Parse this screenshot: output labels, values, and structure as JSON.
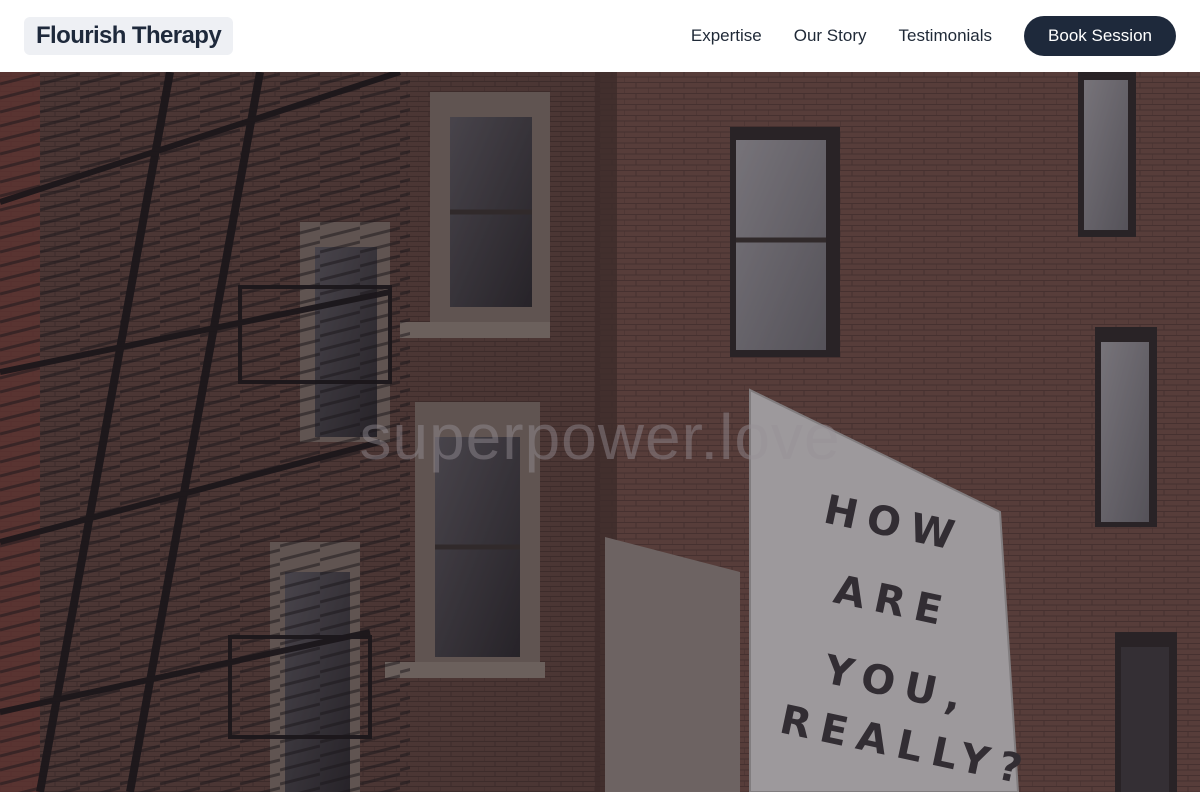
{
  "header": {
    "brand": "Flourish Therapy",
    "nav": {
      "expertise": "Expertise",
      "our_story": "Our Story",
      "testimonials": "Testimonials"
    },
    "cta_label": "Book Session"
  },
  "hero": {
    "heading": "superpower.love",
    "mural_text": [
      "HOW",
      "ARE",
      "YOU,",
      "REALLY?"
    ]
  },
  "colors": {
    "brand_text": "#1e293b",
    "brand_bg": "#eef0f4",
    "cta_bg": "#1e293b",
    "cta_text": "#ffffff",
    "brick": "#6b4a40",
    "mural": "#d9d6d4"
  }
}
